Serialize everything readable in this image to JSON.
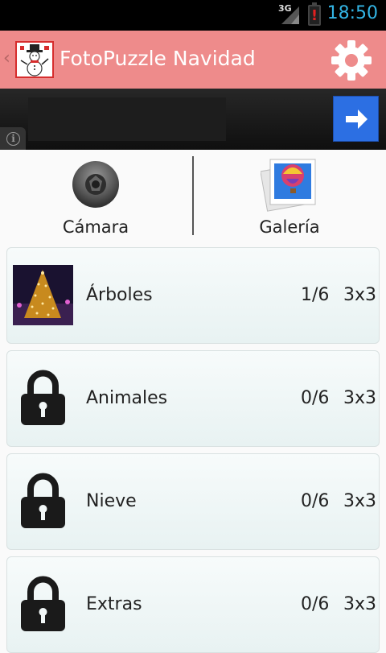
{
  "status_bar": {
    "network_label": "3G",
    "time": "18:50",
    "battery_warning": "!"
  },
  "action_bar": {
    "back_glyph": "‹",
    "title": "FotoPuzzle Navidad",
    "logo_icon": "snowman-icon",
    "settings_icon": "gear-icon"
  },
  "ad_bar": {
    "info_glyph": "i",
    "next_icon": "arrow-right-icon"
  },
  "sources": [
    {
      "label": "Cámara",
      "icon": "camera-icon"
    },
    {
      "label": "Galería",
      "icon": "gallery-icon"
    }
  ],
  "categories": [
    {
      "name": "Árboles",
      "progress": "1/6",
      "size": "3x3",
      "locked": false
    },
    {
      "name": "Animales",
      "progress": "0/6",
      "size": "3x3",
      "locked": true
    },
    {
      "name": "Nieve",
      "progress": "0/6",
      "size": "3x3",
      "locked": true
    },
    {
      "name": "Extras",
      "progress": "0/6",
      "size": "3x3",
      "locked": true
    }
  ],
  "colors": {
    "action_bar": "#ee8b8b",
    "status_time": "#33b5e5",
    "ad_button": "#2c6fe3"
  }
}
